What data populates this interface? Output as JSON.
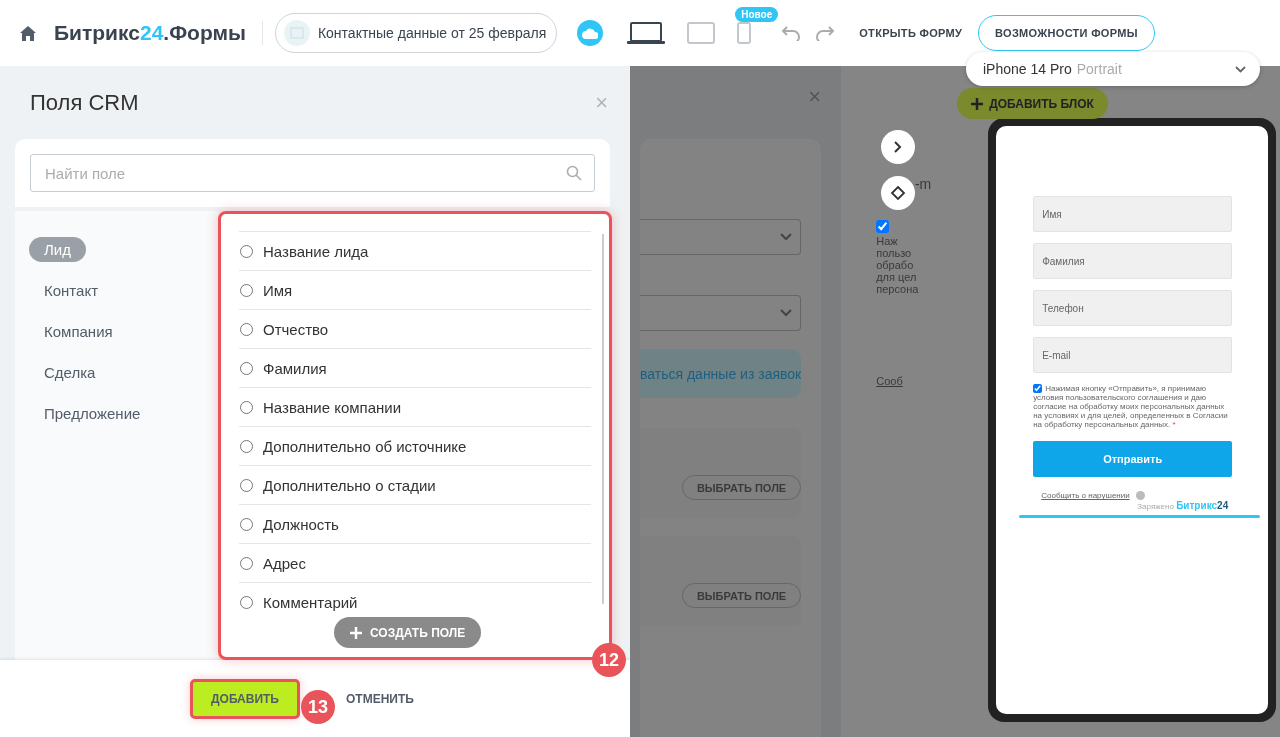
{
  "header": {
    "logo": {
      "name": "Битрикс",
      "number": "24",
      "product": ".Формы"
    },
    "form_name": "Контактные данные от 25 февраля",
    "devices": [
      {
        "kind": "desktop",
        "selected": true
      },
      {
        "kind": "tablet",
        "selected": false
      },
      {
        "kind": "mobile",
        "selected": false,
        "badge": "Новое"
      }
    ],
    "open_link": "ОТКРЫТЬ ФОРМУ",
    "features_button": "ВОЗМОЖНОСТИ ФОРМЫ"
  },
  "device_select": {
    "model": "iPhone 14 Pro",
    "orientation": "Portrait"
  },
  "crm_panel": {
    "title": "Поля CRM",
    "close": "×",
    "search": {
      "placeholder": "Найти поле"
    },
    "entities": [
      {
        "label": "Лид",
        "selected": true
      },
      {
        "label": "Контакт",
        "selected": false
      },
      {
        "label": "Компания",
        "selected": false
      },
      {
        "label": "Сделка",
        "selected": false
      },
      {
        "label": "Предложение",
        "selected": false
      }
    ],
    "fields": [
      {
        "label": "Название лида",
        "selected": false
      },
      {
        "label": "Имя",
        "selected": false
      },
      {
        "label": "Отчество",
        "selected": false
      },
      {
        "label": "Фамилия",
        "selected": false
      },
      {
        "label": "Название компании",
        "selected": false
      },
      {
        "label": "Дополнительно об источнике",
        "selected": false
      },
      {
        "label": "Дополнительно о стадии",
        "selected": false
      },
      {
        "label": "Должность",
        "selected": false
      },
      {
        "label": "Адрес",
        "selected": false
      },
      {
        "label": "Комментарий",
        "selected": false
      }
    ],
    "create_button": "СОЗДАТЬ ПОЛЕ",
    "add_button": "ДОБАВИТЬ",
    "cancel_button": "ОТМЕНИТЬ"
  },
  "annotations": [
    "12",
    "13"
  ],
  "background_editor": {
    "close": "×",
    "info_text": "ваться данные из заявок",
    "select_buttons": [
      "ВЫБРАТЬ ПОЛЕ",
      "ВЫБРАТЬ ПОЛЕ"
    ],
    "add_block_button": "ДОБАВИТЬ БЛОК",
    "form_fragment": {
      "field": "-m",
      "consent_checked": true,
      "consent_lines": [
        "Наж",
        "пользо",
        "обрабо",
        "для цел",
        "персона"
      ],
      "link": "Сооб"
    }
  },
  "preview": {
    "fields": [
      "Имя",
      "Фамилия",
      "Телефон",
      "E-mail"
    ],
    "consent": {
      "checked": true,
      "text": "Нажимая кнопку «Отправить», я принимаю условия пользовательского соглашения и даю согласие на обработку моих персональных данных на условиях и для целей, определенных в Согласии на обработку персональных данных.",
      "required_mark": "*"
    },
    "submit": "Отправить",
    "report_link": "Сообщить о нарушении",
    "powered_by": "Заряжено",
    "brand": "Битрикс",
    "brand_number": "24"
  }
}
